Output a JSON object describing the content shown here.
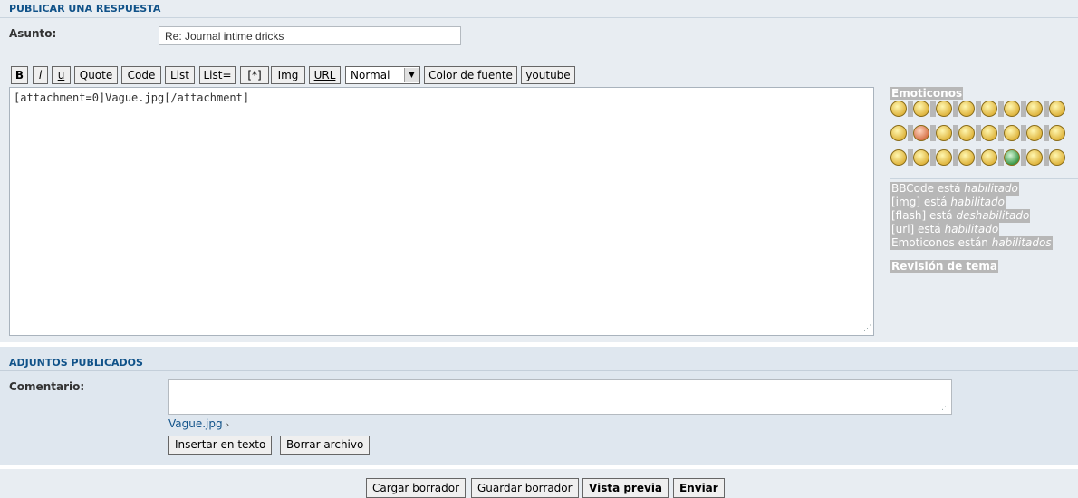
{
  "reply": {
    "section_title": "PUBLICAR UNA RESPUESTA",
    "subject_label": "Asunto:",
    "subject_value": "Re: Journal intime dricks"
  },
  "toolbar": {
    "bold": "B",
    "italic": "i",
    "underline": "u",
    "quote": "Quote",
    "code": "Code",
    "list": "List",
    "list_numbered": "List=",
    "list_item": "[*]",
    "img": "Img",
    "url": "URL",
    "size_selected": "Normal",
    "font_color": "Color de fuente",
    "youtube": "youtube"
  },
  "editor": {
    "content": "[attachment=0]Vague.jpg[/attachment]"
  },
  "sidebar": {
    "emoticons_title": "Emoticonos",
    "emoticon_icons": [
      "grin-icon",
      "laugh-icon",
      "smile-icon",
      "wink-icon",
      "surprised-icon",
      "eek-icon",
      "shock-icon",
      "cool-icon",
      "happy-icon",
      "mad-icon",
      "tongue-icon",
      "sad-icon",
      "neutral-icon",
      "evil-icon",
      "twisted-icon",
      "rolleyes-icon",
      "exclaim-icon",
      "question-icon",
      "idea-icon",
      "arrow-icon",
      "confused-icon",
      "green-icon",
      "geek-icon",
      "uber-geek-icon"
    ],
    "status_lines": [
      {
        "prefix": "BBCode está ",
        "state": "habilitado"
      },
      {
        "prefix": "[img] está ",
        "state": "habilitado"
      },
      {
        "prefix": "[flash] está ",
        "state": "deshabilitado"
      },
      {
        "prefix": "[url] está ",
        "state": "habilitado"
      },
      {
        "prefix": "Emoticonos están ",
        "state": "habilitados"
      }
    ],
    "topic_review": "Revisión de tema"
  },
  "attachments": {
    "section_title": "ADJUNTOS PUBLICADOS",
    "comment_label": "Comentario:",
    "file_name": "Vague.jpg",
    "insert_button": "Insertar en texto",
    "delete_button": "Borrar archivo"
  },
  "actions": {
    "load_draft": "Cargar borrador",
    "save_draft": "Guardar borrador",
    "preview": "Vista previa",
    "submit": "Enviar"
  }
}
